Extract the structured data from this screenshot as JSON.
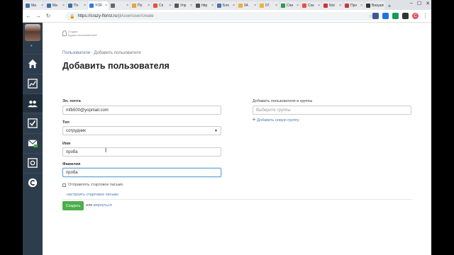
{
  "browser": {
    "tabs": [
      {
        "label": "Ma",
        "color": "#3c6ea8"
      },
      {
        "label": "Ma",
        "color": "#3c6ea8"
      },
      {
        "label": "По",
        "color": "#3c6ea8"
      },
      {
        "label": "YOF",
        "color": "#2f7be0"
      },
      {
        "label": "",
        "color": "#666666"
      },
      {
        "label": "По",
        "color": "#e8a33c"
      },
      {
        "label": "Сп",
        "color": "#e94e3c"
      },
      {
        "label": "Упр",
        "color": "#555555"
      },
      {
        "label": "http",
        "color": "#555555"
      },
      {
        "label": "Бло",
        "color": "#4f6fb0"
      },
      {
        "label": "04.",
        "color": "#e8b33c"
      },
      {
        "label": "07.",
        "color": "#e8b33c"
      },
      {
        "label": "Спи",
        "color": "#2e9a4e"
      },
      {
        "label": "Сок",
        "color": "#e94e3c"
      },
      {
        "label": "Not",
        "color": "#c23b3b"
      },
      {
        "label": "Про",
        "color": "#c23b3b"
      },
      {
        "label": "Визуал",
        "color": "#333333"
      }
    ],
    "url_host": "https://crazy-florist.ru",
    "url_path": "/pl/user/user/create",
    "extensions": [
      "#3b5998",
      "#1a73e8",
      "#0f9d58",
      "#333333"
    ]
  },
  "logo": {
    "line1": "Студия",
    "line2": "Будем пользователей",
    "line3": ""
  },
  "breadcrumb": {
    "root": "Пользователи",
    "separator": "·",
    "current": "Добавить пользователя"
  },
  "page_title": "Добавить пользователя",
  "form": {
    "email_label": "Эл. почта",
    "email_value": "mfb500@yopmail.com",
    "type_label": "Тип",
    "type_value": "сотрудник",
    "firstname_label": "Имя",
    "firstname_value": "проба",
    "lastname_label": "Фамилия",
    "lastname_value": "проба",
    "send_letter_label": "Отправлять стартовое письмо",
    "setup_letter_link": "настроить стартовое письмо",
    "submit_label": "Создать",
    "or_text": "или",
    "back_link": "вернуться"
  },
  "groups": {
    "label": "Добавить пользователя в группы",
    "placeholder": "Выберите группы",
    "add_link": "Добавить новую группу"
  },
  "colors": {
    "sidebar_bg": "#2e3d4c",
    "primary_button": "#4cae4c",
    "link": "#4a7ab0"
  },
  "sidebar_icons": [
    "home-icon",
    "chart-icon",
    "users-icon",
    "checkbox-icon",
    "mail-icon",
    "safe-icon",
    "chat-icon"
  ]
}
